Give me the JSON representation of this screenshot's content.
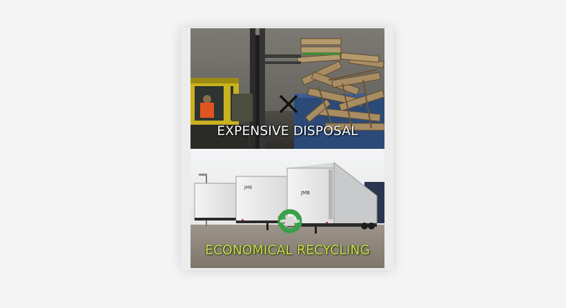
{
  "panels": {
    "top": {
      "caption": "EXPENSIVE DISPOSAL",
      "icon": "x-cross-icon"
    },
    "bottom": {
      "caption": "ECONOMICAL RECYCLING",
      "trailer_markings": [
        "JMB",
        "JMB",
        "JMB"
      ],
      "icon": "recycle-arrows-icon"
    }
  },
  "colors": {
    "disposal_text": "#ffffff",
    "recycling_text": "#c8e04a",
    "recycle_icon": "#3aa04a",
    "page_background": "#f4f4f4"
  }
}
